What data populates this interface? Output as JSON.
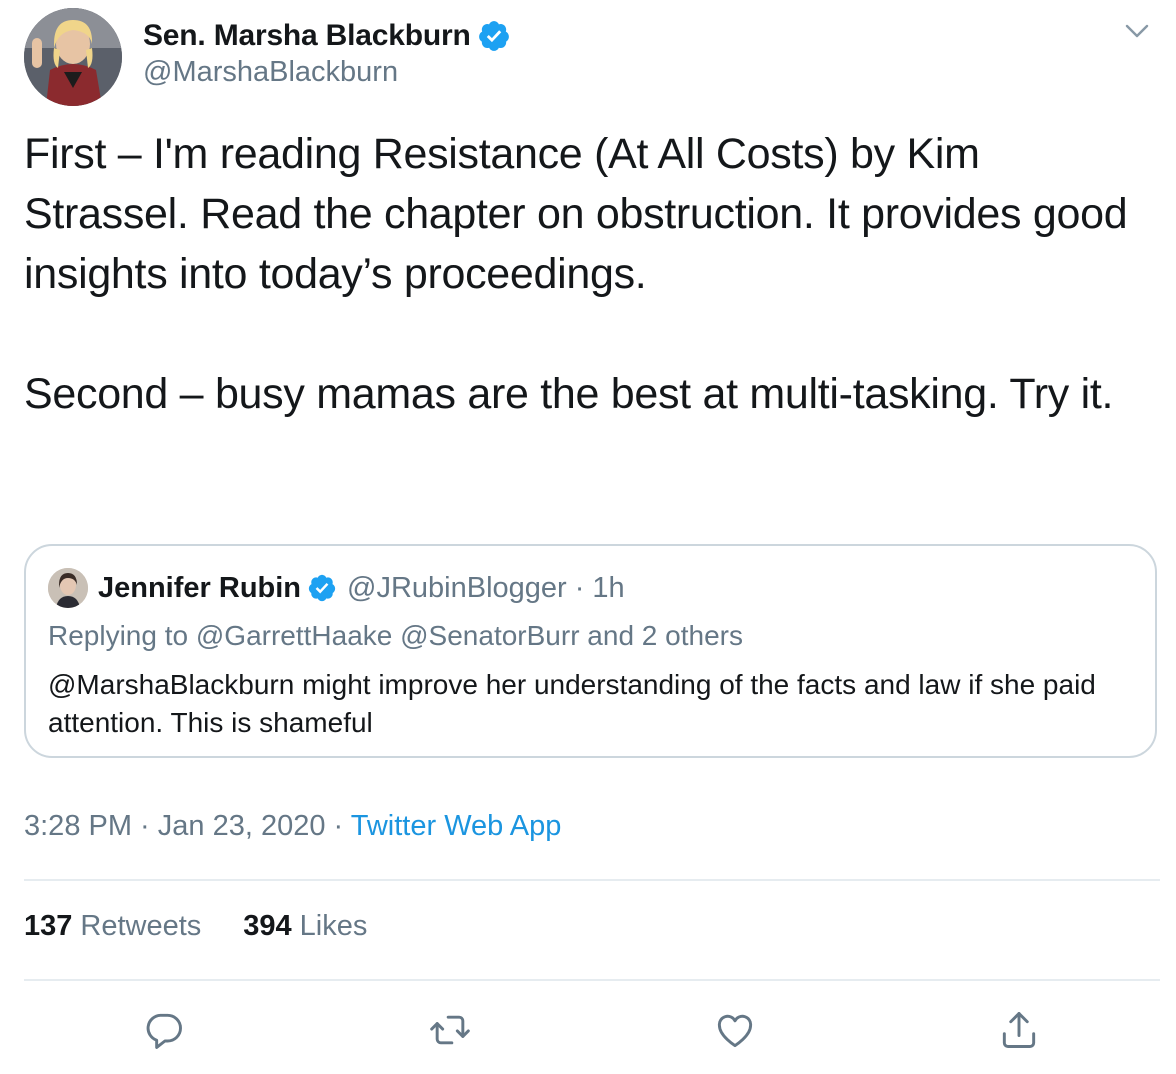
{
  "tweet": {
    "author": {
      "name": "Sen. Marsha Blackburn",
      "handle": "@MarshaBlackburn",
      "avatar_icon": "profile-photo"
    },
    "text": [
      "First – I'm reading Resistance (At All Costs) by Kim Strassel. Read the chapter on obstruction. It provides good insights into today’s proceedings.",
      "Second – busy mamas are the best at multi-tasking. Try it."
    ],
    "quoted": {
      "name": "Jennifer Rubin",
      "handle": "@JRubinBlogger",
      "separator": "·",
      "time": "1h",
      "replying_to": "Replying to @GarrettHaake @SenatorBurr and 2 others",
      "text": "@MarshaBlackburn might improve her understanding of the facts and law if she paid attention. This is shameful"
    },
    "timestamp": "3:28 PM · Jan 23, 2020 ·",
    "source": "Twitter Web App",
    "stats": {
      "retweets_count": "137",
      "retweets_label": "Retweets",
      "likes_count": "394",
      "likes_label": "Likes"
    },
    "colors": {
      "accent": "#1b95e0",
      "verified": "#1da1f2",
      "secondary_text": "#657786",
      "border": "#ccd6dd"
    }
  }
}
